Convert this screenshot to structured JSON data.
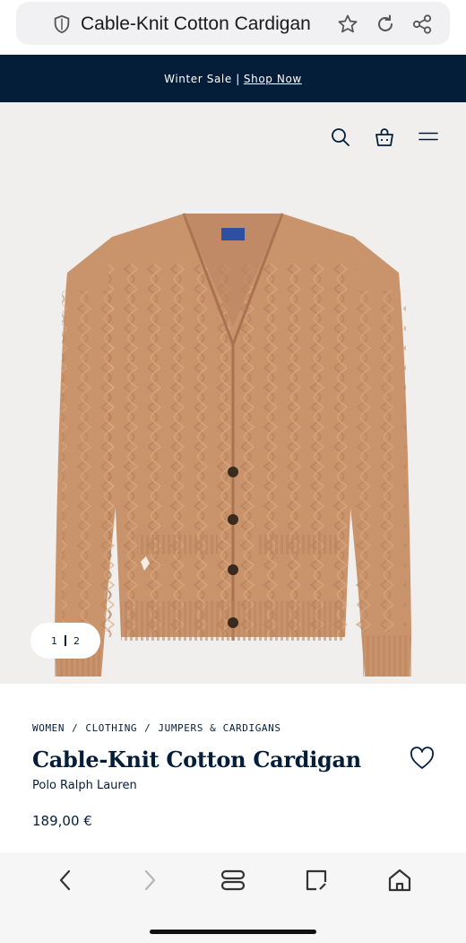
{
  "browser": {
    "page_title": "Cable-Knit Cotton Cardigan",
    "icons": [
      "shield-icon",
      "star-icon",
      "reload-icon",
      "share-icon"
    ]
  },
  "promo": {
    "text": "Winter Sale |",
    "link": "Shop Now"
  },
  "header_icons": [
    "search-icon",
    "bag-icon",
    "menu-icon"
  ],
  "gallery": {
    "page_current": "1",
    "page_next": "2"
  },
  "breadcrumb": [
    "WOMEN",
    "CLOTHING",
    "JUMPERS & CARDIGANS"
  ],
  "breadcrumb_separator": "/",
  "product": {
    "title": "Cable-Knit Cotton Cardigan",
    "brand": "Polo Ralph Lauren",
    "price": "189,00 €"
  },
  "colors": {
    "navy": "#041e3a",
    "hero_bg": "#f0efed",
    "cardigan": "#c9946b"
  },
  "bottom_nav_icons": [
    "back-icon",
    "forward-icon",
    "tabs-icon",
    "edit-icon",
    "home-icon"
  ]
}
